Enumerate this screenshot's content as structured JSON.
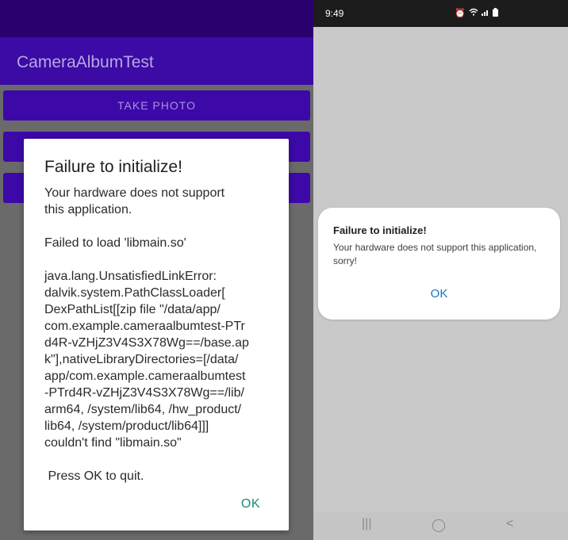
{
  "left_phone": {
    "app_title": "CameraAlbumTest",
    "button_take_photo": "TAKE PHOTO",
    "dialog": {
      "title": "Failure to initialize!",
      "message": "Your hardware does not support\nthis application.\n\nFailed to load 'libmain.so'\n\njava.lang.UnsatisfiedLinkError:\ndalvik.system.PathClassLoader[\nDexPathList[[zip file \"/data/app/\ncom.example.cameraalbumtest-PTr\nd4R-vZHjZ3V4S3X78Wg==/base.ap\nk\"],nativeLibraryDirectories=[/data/\napp/com.example.cameraalbumtest\n-PTrd4R-vZHjZ3V4S3X78Wg==/lib/\narm64, /system/lib64, /hw_product/\nlib64, /system/product/lib64]]]\ncouldn't find \"libmain.so\"\n\n Press OK to quit.",
      "ok": "OK"
    }
  },
  "right_phone": {
    "status_time": "9:49",
    "status_icons": [
      "alarm-icon",
      "wifi-icon",
      "signal-icon",
      "battery-icon"
    ],
    "dialog": {
      "title": "Failure to initialize!",
      "message": "Your hardware does not support this application, sorry!",
      "ok": "OK"
    },
    "nav": {
      "recent": "|||",
      "home": "◯",
      "back": "<"
    }
  },
  "colors": {
    "accent_left": "#3c0aa4",
    "ok_left": "#168a7a",
    "ok_right": "#1a73c8"
  }
}
